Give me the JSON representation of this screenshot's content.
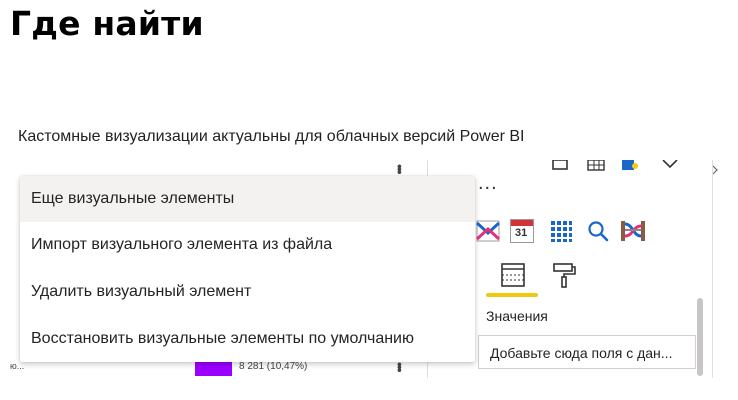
{
  "heading": "Где найти",
  "caption": "Кастомные визуализации актуальны для облачных версий Power BI",
  "canvas": {
    "left_label": "ю...",
    "bar_value_label": "8 281 (10,47%)",
    "bar_color": "#9b00ff"
  },
  "context_menu": {
    "items": [
      {
        "label": "Еще визуальные элементы"
      },
      {
        "label": "Импорт визуального элемента из файла"
      },
      {
        "label": "Удалить визуальный элемент"
      },
      {
        "label": "Восстановить визуальные элементы по умолчанию"
      }
    ]
  },
  "visualizations_pane": {
    "ellipsis": "...",
    "calendar_day": "31",
    "active_tab_color": "#f2c811",
    "values_label": "Значения",
    "values_well_placeholder": "Добавьте сюда поля с дан..."
  }
}
